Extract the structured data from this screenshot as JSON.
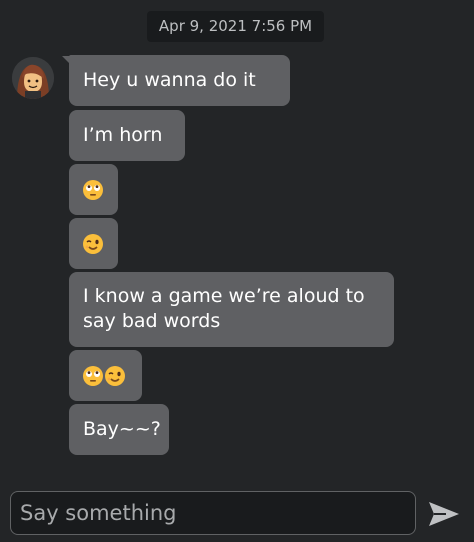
{
  "timestamp": "Apr 9, 2021 7:56 PM",
  "messages": [
    {
      "type": "text",
      "text": "Hey u wanna do it"
    },
    {
      "type": "text",
      "text": "I’m horn"
    },
    {
      "type": "emoji",
      "emojis": [
        "rolling-eyes-emoji"
      ]
    },
    {
      "type": "emoji",
      "emojis": [
        "winking-face-emoji"
      ]
    },
    {
      "type": "text",
      "text": "I know a game we’re aloud to say bad words"
    },
    {
      "type": "emoji",
      "emojis": [
        "rolling-eyes-emoji",
        "winking-face-emoji"
      ]
    },
    {
      "type": "text",
      "text": "Bay~~?"
    }
  ],
  "composer": {
    "placeholder": "Say something"
  },
  "icons": {
    "send": "send-arrow-icon",
    "avatar": "user-avatar"
  },
  "colors": {
    "background": "#232527",
    "bubble": "#5f6063",
    "text": "#ffffff",
    "timestamp_bg": "#191b1d",
    "timestamp_text": "#bdbfc1"
  }
}
